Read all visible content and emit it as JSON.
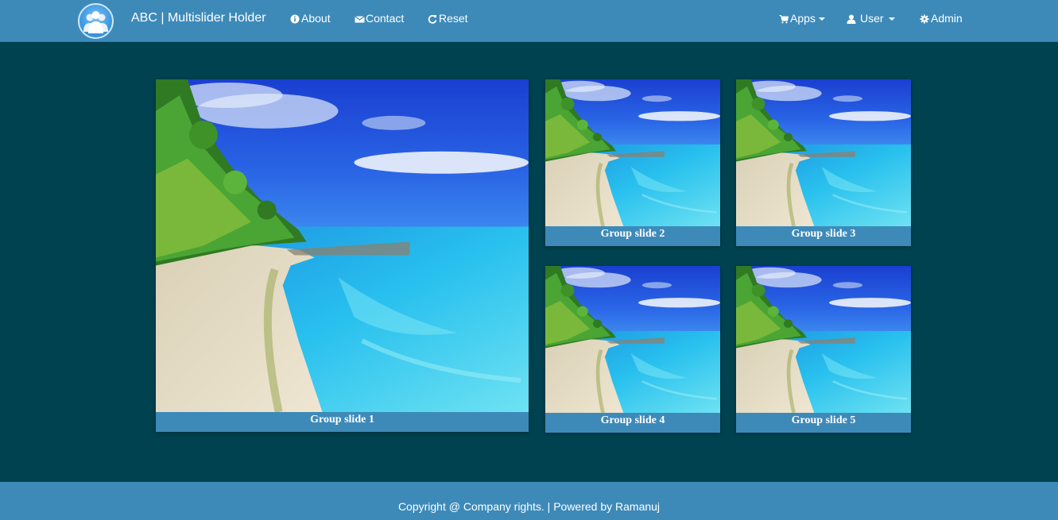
{
  "navbar": {
    "brand": "ABC | Multislider Holder",
    "left_links": [
      {
        "label": "About",
        "icon": "info-icon"
      },
      {
        "label": "Contact",
        "icon": "envelope-icon"
      },
      {
        "label": "Reset",
        "icon": "refresh-icon"
      }
    ],
    "right_links": [
      {
        "label": "Apps",
        "icon": "cart-icon"
      },
      {
        "label": "User",
        "icon": "user-icon"
      },
      {
        "label": "Admin",
        "icon": "gear-icon"
      }
    ]
  },
  "slides": [
    {
      "caption": "Group slide 1"
    },
    {
      "caption": "Group slide 2"
    },
    {
      "caption": "Group slide 3"
    },
    {
      "caption": "Group slide 4"
    },
    {
      "caption": "Group slide 5"
    }
  ],
  "footer": {
    "text": "Copyright @ Company rights. | Powered by Ramanuj"
  },
  "colors": {
    "page_background": "#00424f",
    "navbar": "#3d8ab9",
    "caption_bar": "#3d8ab9",
    "text": "#ffffff"
  }
}
